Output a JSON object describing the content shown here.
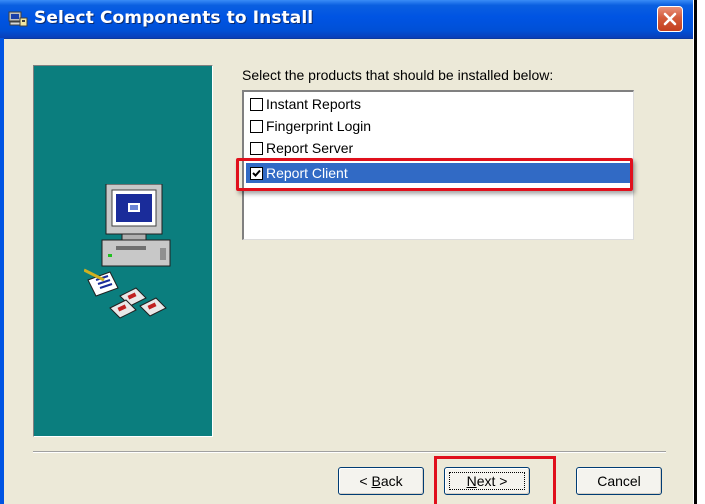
{
  "window": {
    "title": "Select Components to Install",
    "icons": {
      "app": "installer-icon",
      "close": "close-icon"
    }
  },
  "main": {
    "instruction": "Select the products that should be installed below:",
    "products": [
      {
        "label": "Instant Reports",
        "checked": false,
        "selected": false
      },
      {
        "label": "Fingerprint Login",
        "checked": false,
        "selected": false
      },
      {
        "label": "Report Server",
        "checked": false,
        "selected": false
      },
      {
        "label": "Report Client",
        "checked": true,
        "selected": true
      }
    ]
  },
  "buttons": {
    "back": {
      "prefix": "< ",
      "mnemonic": "B",
      "rest": "ack"
    },
    "next": {
      "mnemonic": "N",
      "rest": "ext >"
    },
    "cancel": "Cancel"
  },
  "colors": {
    "titlebar": "#0054e3",
    "side_panel": "#0b7e7e",
    "selection": "#316ac5",
    "annotation": "#e0101c",
    "dialog_bg": "#ece9d8"
  }
}
